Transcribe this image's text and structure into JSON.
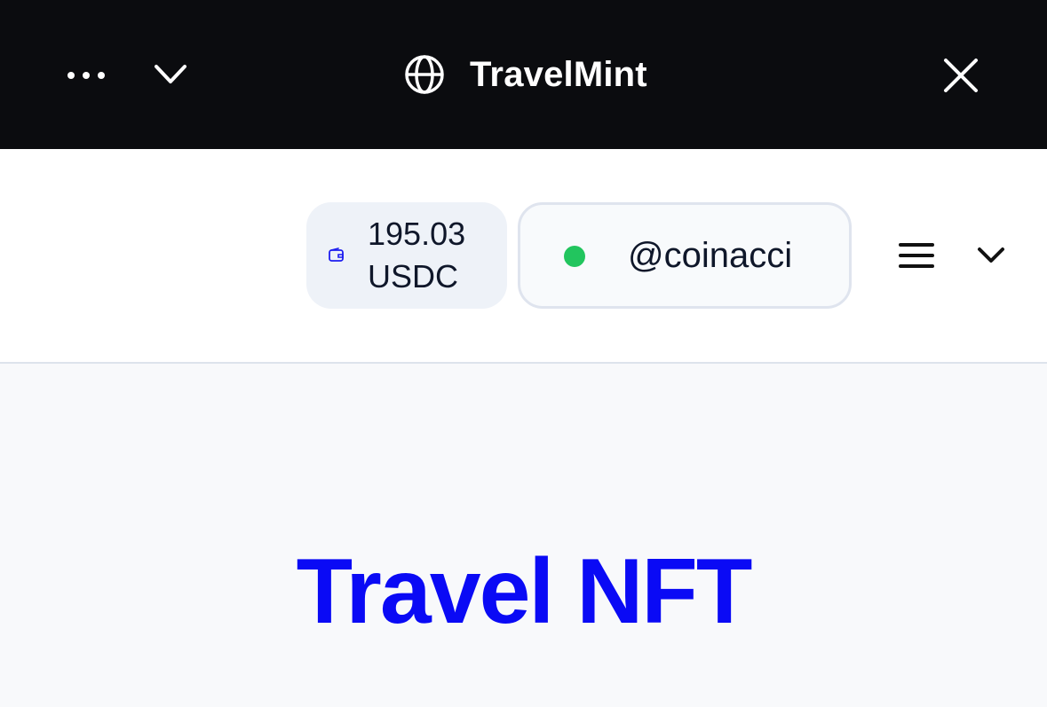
{
  "topbar": {
    "more_icon": "more-horizontal-icon",
    "dropdown_icon": "chevron-down-icon",
    "brand_icon": "globe-icon",
    "title": "TravelMint",
    "close_icon": "close-icon"
  },
  "header": {
    "balance": {
      "amount": "195.03",
      "currency": "USDC",
      "icon": "wallet-icon"
    },
    "account": {
      "handle": "@coinacci",
      "status_color": "#22c55e"
    },
    "menu_icon": "hamburger-menu-icon",
    "menu_dropdown_icon": "chevron-down-icon"
  },
  "main": {
    "heading": "Travel NFT",
    "heading_color": "#0a0af5"
  }
}
